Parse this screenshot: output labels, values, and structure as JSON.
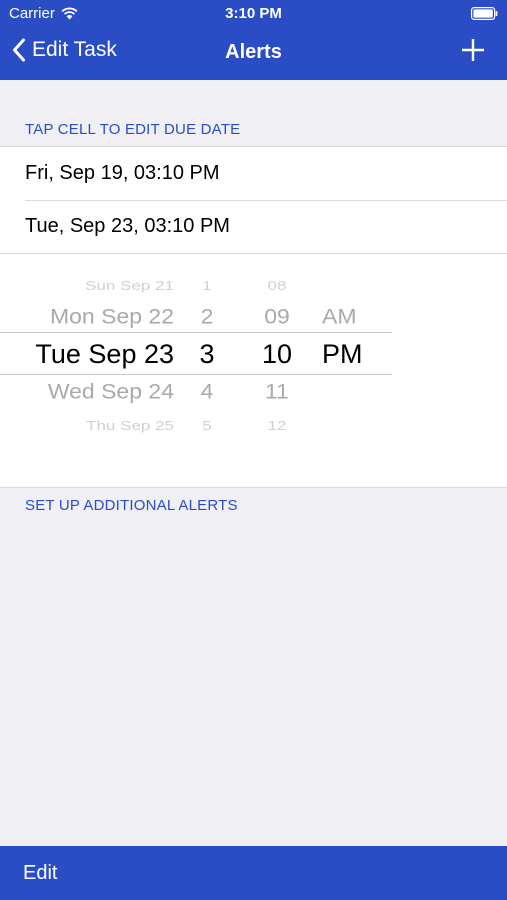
{
  "status_bar": {
    "carrier": "Carrier",
    "time": "3:10 PM",
    "wifi_icon": "wifi-icon",
    "battery_icon": "battery-icon"
  },
  "nav": {
    "back_label": "Edit Task",
    "title": "Alerts",
    "back_icon": "chevron-left-icon",
    "add_icon": "plus-icon"
  },
  "due_date_section": {
    "header": "TAP CELL TO EDIT DUE DATE",
    "cells": [
      "Fri, Sep 19, 03:10 PM",
      "Tue, Sep 23, 03:10 PM"
    ]
  },
  "picker": {
    "dates": [
      "Sun Sep 21",
      "Mon Sep 22",
      "Tue Sep 23",
      "Wed Sep 24",
      "Thu Sep 25"
    ],
    "hours": [
      "1",
      "2",
      "3",
      "4",
      "5"
    ],
    "minutes": [
      "08",
      "09",
      "10",
      "11",
      "12"
    ],
    "ampm": [
      "AM",
      "PM"
    ],
    "selected": {
      "date": "Tue Sep 23",
      "hour": "3",
      "minute": "10",
      "ampm": "PM"
    }
  },
  "additional_section": {
    "header": "SET UP ADDITIONAL ALERTS"
  },
  "toolbar": {
    "edit_label": "Edit"
  },
  "colors": {
    "accent": "#2a4dc6",
    "background": "#efeff4"
  }
}
